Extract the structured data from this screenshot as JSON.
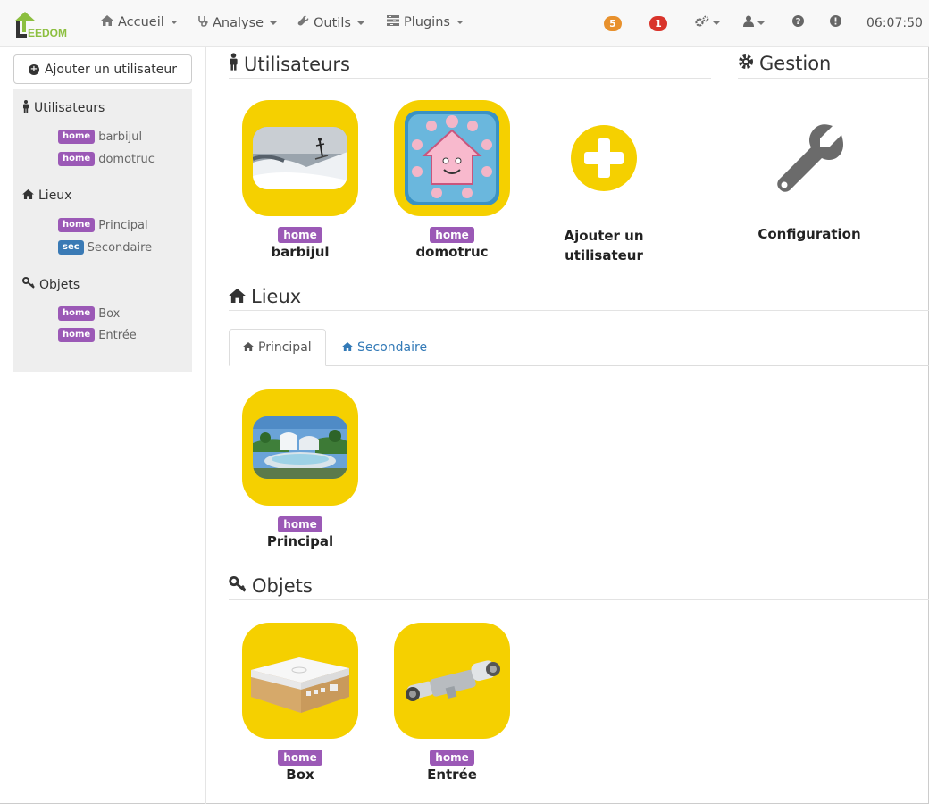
{
  "app": {
    "logo_text": "EEDOM"
  },
  "nav": {
    "accueil": "Accueil",
    "analyse": "Analyse",
    "outils": "Outils",
    "plugins": "Plugins",
    "badge_warnings": "5",
    "badge_errors": "1",
    "clock": "06:07:50"
  },
  "sidebar": {
    "add_user": "Ajouter un utilisateur",
    "users_title": "Utilisateurs",
    "users": [
      {
        "tag": "home",
        "name": "barbijul"
      },
      {
        "tag": "home",
        "name": "domotruc"
      }
    ],
    "places_title": "Lieux",
    "places": [
      {
        "tag": "home",
        "name": "Principal"
      },
      {
        "tag": "sec",
        "name": "Secondaire"
      }
    ],
    "objects_title": "Objets",
    "objects": [
      {
        "tag": "home",
        "name": "Box"
      },
      {
        "tag": "home",
        "name": "Entrée"
      }
    ]
  },
  "main": {
    "users_title": "Utilisateurs",
    "users": [
      {
        "tag": "home",
        "name": "barbijul"
      },
      {
        "tag": "home",
        "name": "domotruc"
      }
    ],
    "add_user_line1": "Ajouter un",
    "add_user_line2": "utilisateur",
    "gestion_title": "Gestion",
    "configuration": "Configuration",
    "places_title": "Lieux",
    "tabs": [
      {
        "label": "Principal",
        "active": true
      },
      {
        "label": "Secondaire",
        "active": false
      }
    ],
    "places": [
      {
        "tag": "home",
        "name": "Principal"
      }
    ],
    "objects_title": "Objets",
    "objects": [
      {
        "tag": "home",
        "name": "Box"
      },
      {
        "tag": "home",
        "name": "Entrée"
      }
    ]
  },
  "colors": {
    "tile_yellow": "#f5d000",
    "label_home": "#9b59b6",
    "label_sec": "#3a7ab5",
    "badge_orange": "#e8912d",
    "badge_red": "#d9342b"
  }
}
